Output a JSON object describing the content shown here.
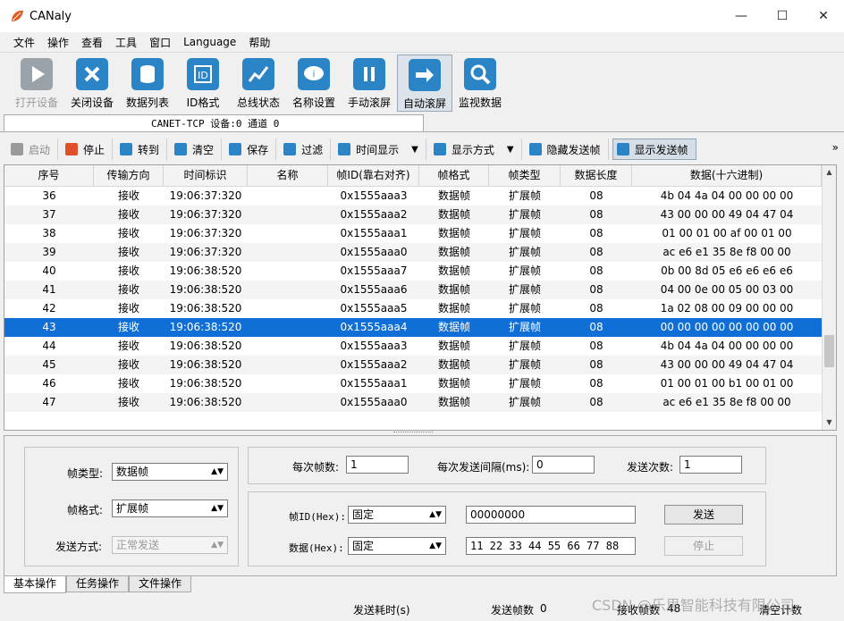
{
  "window": {
    "title": "CANaly",
    "minimize": "—",
    "maximize": "☐",
    "close": "✕"
  },
  "menu": [
    "文件",
    "操作",
    "查看",
    "工具",
    "窗口",
    "Language",
    "帮助"
  ],
  "toolbar": [
    {
      "label": "打开设备",
      "icon": "play-icon",
      "color": "#9aa3aa",
      "disabled": true
    },
    {
      "label": "关闭设备",
      "icon": "close-device-icon",
      "color": "#2a84c6",
      "disabled": false
    },
    {
      "label": "数据列表",
      "icon": "database-icon",
      "color": "#2a84c6",
      "disabled": false
    },
    {
      "label": "ID格式",
      "icon": "id-format-icon",
      "color": "#2a84c6",
      "disabled": false
    },
    {
      "label": "总线状态",
      "icon": "bus-status-icon",
      "color": "#2a84c6",
      "disabled": false
    },
    {
      "label": "名称设置",
      "icon": "name-setting-icon",
      "color": "#2a84c6",
      "disabled": false
    },
    {
      "label": "手动滚屏",
      "icon": "pause-icon",
      "color": "#2a84c6",
      "disabled": false
    },
    {
      "label": "自动滚屏",
      "icon": "arrow-right-icon",
      "color": "#2a84c6",
      "disabled": false,
      "active": true
    },
    {
      "label": "监视数据",
      "icon": "magnifier-icon",
      "color": "#2a84c6",
      "disabled": false
    }
  ],
  "device_tab": "CANET-TCP 设备:0 通道 0",
  "controls": [
    {
      "label": "启动",
      "icon": "start-icon",
      "color": "#9a9a9a",
      "disabled": true
    },
    {
      "label": "停止",
      "icon": "stop-icon",
      "color": "#e0502a",
      "disabled": false
    },
    {
      "label": "转到",
      "icon": "goto-icon",
      "color": "#2a84c6",
      "disabled": false
    },
    {
      "label": "清空",
      "icon": "clear-icon",
      "color": "#2a84c6",
      "disabled": false
    },
    {
      "label": "保存",
      "icon": "save-icon",
      "color": "#2a84c6",
      "disabled": false
    },
    {
      "label": "过滤",
      "icon": "filter-icon",
      "color": "#2a84c6",
      "disabled": false
    },
    {
      "label": "时间显示",
      "icon": "time-icon",
      "color": "#2a84c6",
      "disabled": false,
      "dropdown": true
    },
    {
      "label": "显示方式",
      "icon": "display-mode-icon",
      "color": "#2a84c6",
      "disabled": false,
      "dropdown": true
    },
    {
      "label": "隐藏发送帧",
      "icon": "hide-send-icon",
      "color": "#2a84c6",
      "disabled": false
    },
    {
      "label": "显示发送帧",
      "icon": "show-send-icon",
      "color": "#2a84c6",
      "disabled": false,
      "active": true
    }
  ],
  "controls_more": "»",
  "table": {
    "columns": [
      "序号",
      "传输方向",
      "时间标识",
      "名称",
      "帧ID(靠右对齐)",
      "帧格式",
      "帧类型",
      "数据长度",
      "数据(十六进制)"
    ],
    "rows": [
      [
        "36",
        "接收",
        "19:06:37:320",
        "",
        "0x1555aaa3",
        "数据帧",
        "扩展帧",
        "08",
        "4b 04 4a 04 00 00 00 00"
      ],
      [
        "37",
        "接收",
        "19:06:37:320",
        "",
        "0x1555aaa2",
        "数据帧",
        "扩展帧",
        "08",
        "43 00 00 00 49 04 47 04"
      ],
      [
        "38",
        "接收",
        "19:06:37:320",
        "",
        "0x1555aaa1",
        "数据帧",
        "扩展帧",
        "08",
        "01 00 01 00 af 00 01 00"
      ],
      [
        "39",
        "接收",
        "19:06:37:320",
        "",
        "0x1555aaa0",
        "数据帧",
        "扩展帧",
        "08",
        "ac e6 e1 35 8e f8 00 00"
      ],
      [
        "40",
        "接收",
        "19:06:38:520",
        "",
        "0x1555aaa7",
        "数据帧",
        "扩展帧",
        "08",
        "0b 00 8d 05 e6 e6 e6 e6"
      ],
      [
        "41",
        "接收",
        "19:06:38:520",
        "",
        "0x1555aaa6",
        "数据帧",
        "扩展帧",
        "08",
        "04 00 0e 00 05 00 03 00"
      ],
      [
        "42",
        "接收",
        "19:06:38:520",
        "",
        "0x1555aaa5",
        "数据帧",
        "扩展帧",
        "08",
        "1a 02 08 00 09 00 00 00"
      ],
      [
        "43",
        "接收",
        "19:06:38:520",
        "",
        "0x1555aaa4",
        "数据帧",
        "扩展帧",
        "08",
        "00 00 00 00 00 00 00 00"
      ],
      [
        "44",
        "接收",
        "19:06:38:520",
        "",
        "0x1555aaa3",
        "数据帧",
        "扩展帧",
        "08",
        "4b 04 4a 04 00 00 00 00"
      ],
      [
        "45",
        "接收",
        "19:06:38:520",
        "",
        "0x1555aaa2",
        "数据帧",
        "扩展帧",
        "08",
        "43 00 00 00 49 04 47 04"
      ],
      [
        "46",
        "接收",
        "19:06:38:520",
        "",
        "0x1555aaa1",
        "数据帧",
        "扩展帧",
        "08",
        "01 00 01 00 b1 00 01 00"
      ],
      [
        "47",
        "接收",
        "19:06:38:520",
        "",
        "0x1555aaa0",
        "数据帧",
        "扩展帧",
        "08",
        "ac e6 e1 35 8e f8 00 00"
      ]
    ],
    "selected_row": 7
  },
  "send_panel": {
    "frame_type_label": "帧类型:",
    "frame_type_value": "数据帧",
    "frame_format_label": "帧格式:",
    "frame_format_value": "扩展帧",
    "send_mode_label": "发送方式:",
    "send_mode_value": "正常发送",
    "frames_per_send_label": "每次帧数:",
    "frames_per_send_value": "1",
    "interval_label": "每次发送间隔(ms):",
    "interval_value": "0",
    "send_count_label": "发送次数:",
    "send_count_value": "1",
    "frame_id_label": "帧ID(Hex):",
    "frame_id_mode": "固定",
    "frame_id_value": "00000000",
    "data_label": "数据(Hex):",
    "data_mode": "固定",
    "data_value": "11 22 33 44 55 66 77 88",
    "send_button": "发送",
    "stop_button": "停止"
  },
  "bottom_tabs": [
    "基本操作",
    "任务操作",
    "文件操作"
  ],
  "status": {
    "send_time": "发送耗时(s)",
    "send_frames": "发送帧数",
    "send_frames_value": "0",
    "recv_frames": "接收帧数",
    "recv_frames_value": "48",
    "clear_count": "清空计数"
  },
  "watermark": "CSDN @乐思智能科技有限公司"
}
